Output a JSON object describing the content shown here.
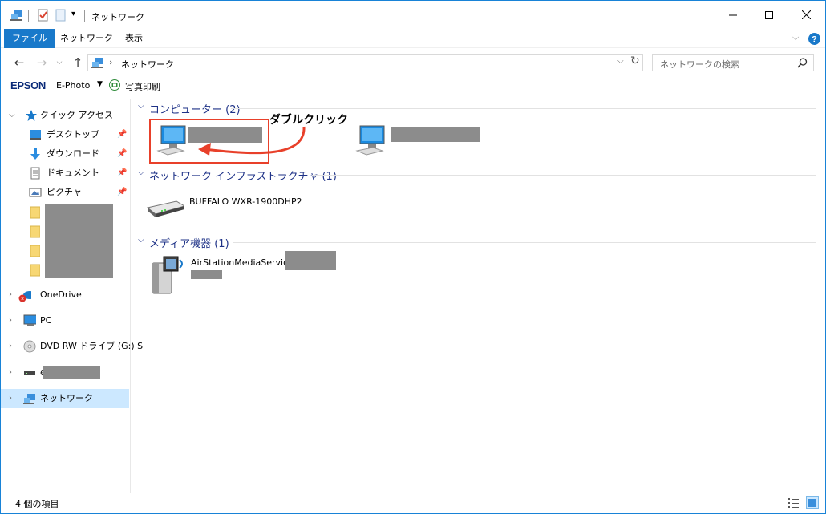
{
  "window": {
    "title": "ネットワーク"
  },
  "ribbon": {
    "tabs": [
      "ファイル",
      "ネットワーク",
      "表示"
    ]
  },
  "address": {
    "path": "ネットワーク",
    "search_placeholder": "ネットワークの検索"
  },
  "epson": {
    "logo": "EPSON",
    "app": "E-Photo",
    "print_label": "写真印刷"
  },
  "nav": {
    "quick_access": "クイック アクセス",
    "items": [
      "デスクトップ",
      "ダウンロード",
      "ドキュメント",
      "ピクチャ"
    ],
    "onedrive": "OneDrive",
    "pc": "PC",
    "dvd": "DVD RW ドライブ (G:) S",
    "drive_prefix": "e",
    "network": "ネットワーク"
  },
  "groups": {
    "computers": {
      "header": "コンピューター (2)"
    },
    "infra": {
      "header": "ネットワーク インフラストラクチャ (1)",
      "item": "BUFFALO WXR-1900DHP2"
    },
    "media": {
      "header": "メディア機器 (1)",
      "item": "AirStationMediaService["
    }
  },
  "annotation": {
    "text": "ダブルクリック"
  },
  "status": {
    "count": "4 個の項目"
  },
  "colors": {
    "accent": "#1979ca",
    "selection": "#cce8ff",
    "highlight": "#e8402a",
    "group_header": "#1e3287"
  }
}
